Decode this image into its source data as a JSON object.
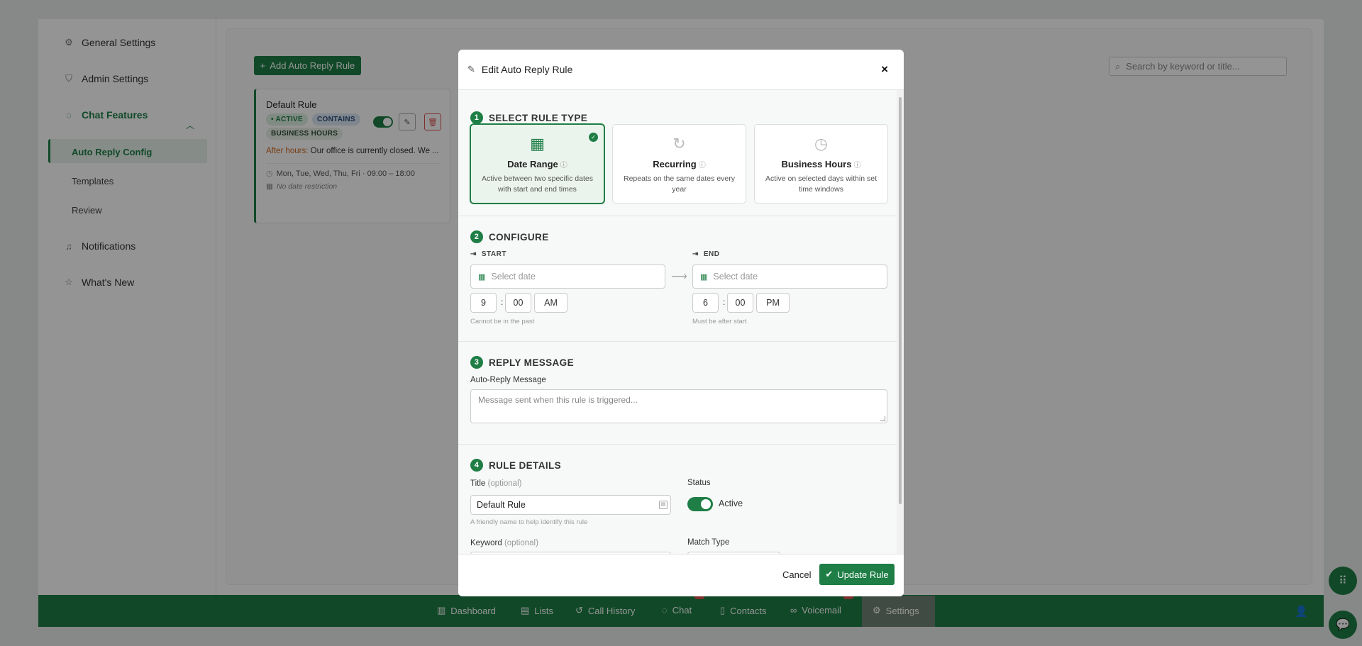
{
  "sidebar": {
    "items": [
      {
        "label": "General Settings",
        "icon": "gear-icon"
      },
      {
        "label": "Admin Settings",
        "icon": "shield-icon"
      },
      {
        "label": "Chat Features",
        "icon": "chat-bubble-icon"
      },
      {
        "label": "Notifications",
        "icon": "bell-icon"
      },
      {
        "label": "What's New",
        "icon": "star-icon"
      }
    ],
    "sub_items": [
      "Auto Reply Config",
      "Templates",
      "Review"
    ]
  },
  "main": {
    "add_button": "Add Auto Reply Rule",
    "search_placeholder": "Search by keyword or title...",
    "rule_card": {
      "title": "Default Rule",
      "badges": [
        "• ACTIVE",
        "CONTAINS",
        "BUSINESS HOURS"
      ],
      "message_prefix": "After hours:",
      "message": "Our office is currently closed. We ...",
      "schedule": "Mon, Tue, Wed, Thu, Fri · 09:00 – 18:00",
      "date_restriction": "No date restriction"
    }
  },
  "bottom_nav": {
    "items": [
      {
        "label": "Dashboard",
        "icon": "chart-icon"
      },
      {
        "label": "Lists",
        "icon": "list-icon"
      },
      {
        "label": "Call History",
        "icon": "history-icon"
      },
      {
        "label": "Chat",
        "icon": "chat-icon"
      },
      {
        "label": "Contacts",
        "icon": "phone-icon"
      },
      {
        "label": "Voicemail",
        "icon": "voicemail-icon"
      },
      {
        "label": "Settings",
        "icon": "gear-icon"
      }
    ]
  },
  "modal": {
    "title": "Edit Auto Reply Rule",
    "close": "×",
    "section1": {
      "number": "1",
      "title": "SELECT RULE TYPE",
      "types": [
        {
          "title": "Date Range",
          "desc": "Active between two specific dates with start and end times",
          "selected": true
        },
        {
          "title": "Recurring",
          "desc": "Repeats on the same dates every year",
          "selected": false
        },
        {
          "title": "Business Hours",
          "desc": "Active on selected days within set time windows",
          "selected": false
        }
      ]
    },
    "section2": {
      "number": "2",
      "title": "CONFIGURE",
      "start_label": "START",
      "end_label": "END",
      "start_placeholder": "Select date",
      "end_placeholder": "Select date",
      "start_time": {
        "hour": "9",
        "minute": "00",
        "ampm": "AM"
      },
      "end_time": {
        "hour": "6",
        "minute": "00",
        "ampm": "PM"
      },
      "start_hint": "Cannot be in the past",
      "end_hint": "Must be after start"
    },
    "section3": {
      "number": "3",
      "title": "REPLY MESSAGE",
      "label": "Auto-Reply Message",
      "placeholder": "Message sent when this rule is triggered..."
    },
    "section4": {
      "number": "4",
      "title": "RULE DETAILS",
      "title_label": "Title",
      "optional": "(optional)",
      "title_value": "Default Rule",
      "title_hint": "A friendly name to help identify this rule",
      "status_label": "Status",
      "status_value": "Active",
      "keyword_label": "Keyword",
      "match_type_label": "Match Type"
    },
    "footer": {
      "cancel": "Cancel",
      "update": "Update Rule"
    }
  },
  "colors": {
    "primary": "#1e7e45",
    "danger": "#d9534f",
    "overlay": "rgba(0,0,0,0.42)"
  }
}
